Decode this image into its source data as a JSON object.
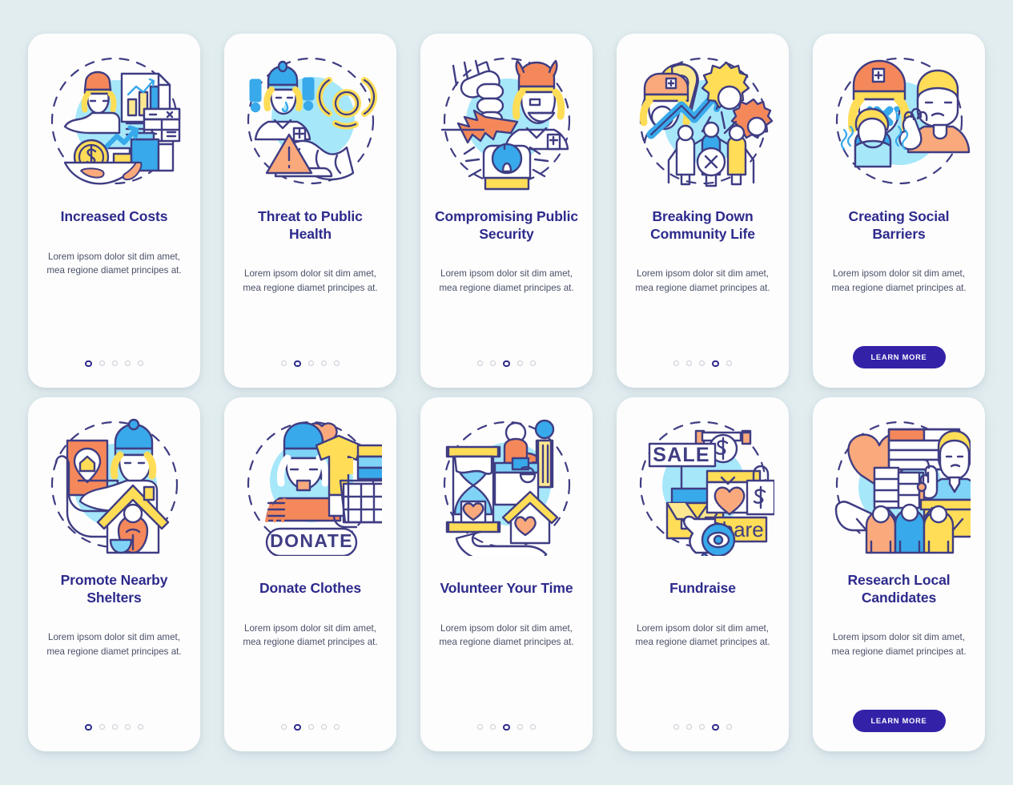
{
  "theme": {
    "page_background": "#e2edf0",
    "card_background": "#fdfdfd",
    "title_color": "#2d2a8c",
    "body_color": "#4b5068",
    "accent_button": "#3322a8",
    "dot_active": "#2d2a8c",
    "dot_inactive": "#c9ccd6",
    "illustration_stroke": "#3f3d83",
    "illustration_blue_circle": "#a6e7fa",
    "illustration_orange": "#f5885a",
    "illustration_light_orange": "#f9a97b",
    "illustration_yellow": "#ffdd57",
    "illustration_light_yellow": "#fde890",
    "illustration_blue": "#38a9ea",
    "illustration_light_blue": "#7fd3f7"
  },
  "body_text": "Lorem ipsom dolor sit dim amet, mea regione diamet principes at.",
  "cta_label": "LEARN MORE",
  "screens": [
    {
      "id": "increased-costs",
      "title": "Increased Costs",
      "body": "Lorem ipsom dolor sit dim amet, mea regione diamet principes at.",
      "dots": {
        "count": 5,
        "active": 0
      },
      "has_cta": false,
      "illustration": "increased-costs-illustration"
    },
    {
      "id": "threat-to-public-health",
      "title": "Threat to Public Health",
      "body": "Lorem ipsom dolor sit dim amet, mea regione diamet principes at.",
      "dots": {
        "count": 5,
        "active": 1
      },
      "has_cta": false,
      "illustration": "threat-to-public-health-illustration"
    },
    {
      "id": "compromising-public-security",
      "title": "Compromising Public Security",
      "body": "Lorem ipsom dolor sit dim amet, mea regione diamet principes at.",
      "dots": {
        "count": 5,
        "active": 2
      },
      "has_cta": false,
      "illustration": "compromising-public-security-illustration"
    },
    {
      "id": "breaking-down-community-life",
      "title": "Breaking Down Community Life",
      "body": "Lorem ipsom dolor sit dim amet, mea regione diamet principes at.",
      "dots": {
        "count": 5,
        "active": 3
      },
      "has_cta": false,
      "illustration": "breaking-down-community-life-illustration"
    },
    {
      "id": "creating-social-barriers",
      "title": "Creating Social Barriers",
      "body": "Lorem ipsom dolor sit dim amet, mea regione diamet principes at.",
      "dots": {
        "count": 0,
        "active": -1
      },
      "has_cta": true,
      "cta_label": "LEARN MORE",
      "illustration": "creating-social-barriers-illustration"
    },
    {
      "id": "promote-nearby-shelters",
      "title": "Promote Nearby Shelters",
      "body": "Lorem ipsom dolor sit dim amet, mea regione diamet principes at.",
      "dots": {
        "count": 5,
        "active": 0
      },
      "has_cta": false,
      "illustration": "promote-nearby-shelters-illustration"
    },
    {
      "id": "donate-clothes",
      "title": "Donate Clothes",
      "body": "Lorem ipsom dolor sit dim amet, mea regione diamet principes at.",
      "dots": {
        "count": 5,
        "active": 1
      },
      "has_cta": false,
      "illustration": "donate-clothes-illustration",
      "illustration_label": "DONATE"
    },
    {
      "id": "volunteer-your-time",
      "title": "Volunteer Your Time",
      "body": "Lorem ipsom dolor sit dim amet, mea regione diamet principes at.",
      "dots": {
        "count": 5,
        "active": 2
      },
      "has_cta": false,
      "illustration": "volunteer-your-time-illustration"
    },
    {
      "id": "fundraise",
      "title": "Fundraise",
      "body": "Lorem ipsom dolor sit dim amet, mea regione diamet principes at.",
      "dots": {
        "count": 5,
        "active": 3
      },
      "has_cta": false,
      "illustration": "fundraise-illustration",
      "illustration_labels": [
        "SALE",
        "Share"
      ]
    },
    {
      "id": "research-local-candidates",
      "title": "Research Local Candidates",
      "body": "Lorem ipsom dolor sit dim amet, mea regione diamet principes at.",
      "dots": {
        "count": 0,
        "active": -1
      },
      "has_cta": true,
      "cta_label": "LEARN MORE",
      "illustration": "research-local-candidates-illustration"
    }
  ]
}
